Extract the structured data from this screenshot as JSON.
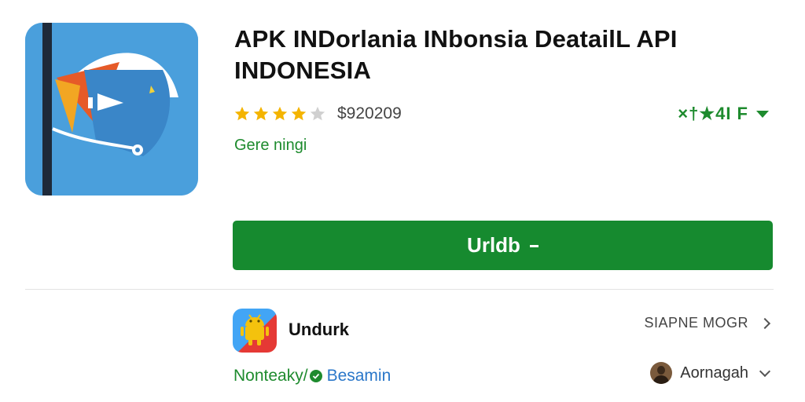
{
  "app": {
    "title_line1": "APK INDorlania INbonsia DeatailL API",
    "title_line2": "INDONESIA",
    "rating_stars": 4,
    "rating_max": 5,
    "price": "$920209",
    "score": "×†★4I F",
    "developer": "Gere ningi",
    "icon": "paper-plane-app-icon"
  },
  "actions": {
    "install_label": "Urldb"
  },
  "secondary": {
    "uninstall_label": "Undurk",
    "uninstall_link": "SIAPNE MOGR",
    "category_tag": "Nonteaky/",
    "verified_tag": "Besamin",
    "user_name": "Aornagah"
  },
  "colors": {
    "brand_green": "#168a2f",
    "star_gold": "#f4b400",
    "link_blue": "#2a77c9",
    "icon_blue": "#4a9fdc"
  }
}
